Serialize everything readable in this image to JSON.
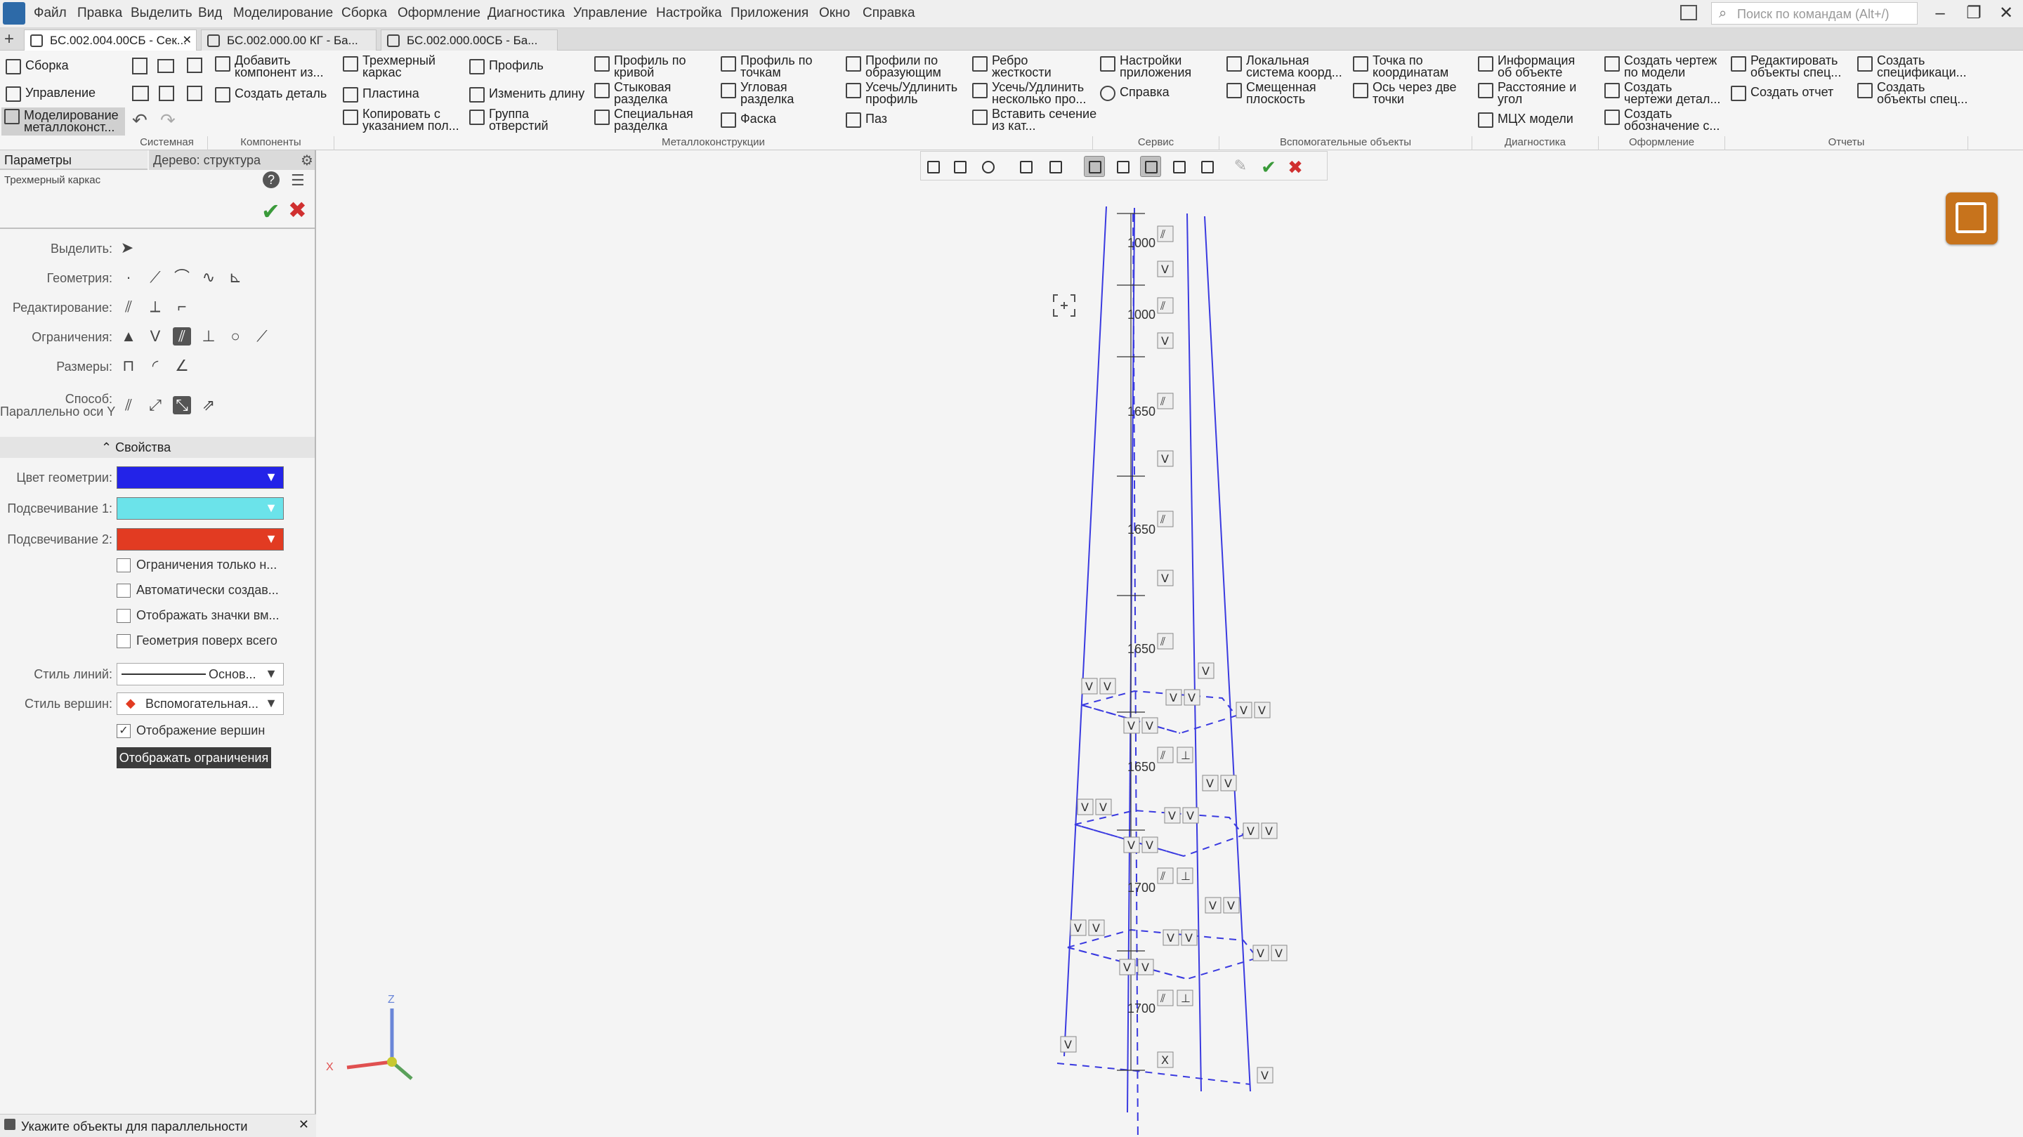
{
  "menu": [
    "Файл",
    "Правка",
    "Выделить",
    "Вид",
    "Моделирование",
    "Сборка",
    "Оформление",
    "Диагностика",
    "Управление",
    "Настройка",
    "Приложения",
    "Окно",
    "Справка"
  ],
  "search": {
    "placeholder": "Поиск по командам (Alt+/)"
  },
  "window": {
    "minimize": "–",
    "restore": "❐",
    "close": "✕"
  },
  "tabs": [
    {
      "label": "БС.002.004.00СБ - Сек...",
      "active": true
    },
    {
      "label": "БС.002.000.00 КГ - Ба...",
      "active": false
    },
    {
      "label": "БС.002.000.00СБ - Ба...",
      "active": false
    }
  ],
  "ribbon": {
    "modes": [
      "Сборка",
      "Управление",
      "Моделирование металлоконст..."
    ],
    "buttons": {
      "add_component": "Добавить компонент из...",
      "create_part": "Создать деталь",
      "frame3d": "Трехмерный каркас",
      "plate": "Пластина",
      "copy_with": "Копировать с указанием пол...",
      "profile": "Профиль",
      "change_length": "Изменить длину",
      "hole_group": "Группа отверстий",
      "profile_curve": "Профиль по кривой",
      "butt_groove": "Стыковая разделка",
      "special_groove": "Специальная разделка",
      "profile_points": "Профиль по точкам",
      "corner_groove": "Угловая разделка",
      "chamfer": "Фаска",
      "profiles_generatrix": "Профили по образующим",
      "trim_extend_profile": "Усечь/Удлинить профиль",
      "slot": "Паз",
      "rib": "Ребро жесткости",
      "trim_extend_multi": "Усечь/Удлинить несколько про...",
      "insert_section": "Вставить сечение из кат...",
      "app_settings": "Настройки приложения",
      "help": "Справка",
      "local_cs": "Локальная система коорд...",
      "offset_plane": "Смещенная плоскость",
      "point_coords": "Точка по координатам",
      "axis_two_points": "Ось через две точки",
      "object_info": "Информация об объекте",
      "distance_angle": "Расстояние и угол",
      "mass_props": "МЦХ модели",
      "create_drawing": "Создать чертеж по модели",
      "create_part_drawings": "Создать чертежи детал...",
      "create_designation": "Создать обозначение с...",
      "edit_spec_objects": "Редактировать объекты спец...",
      "create_report": "Создать отчет",
      "create_spec": "Создать спецификаци...",
      "create_spec_objects": "Создать объекты спец..."
    },
    "groups": [
      "Системная",
      "Компоненты",
      "Металлоконструкции",
      "Сервис",
      "Вспомогательные объекты",
      "Диагностика",
      "Оформление",
      "Отчеты"
    ]
  },
  "panel": {
    "tab_params": "Параметры",
    "tab_tree": "Дерево: структура",
    "subtitle": "Трехмерный каркас",
    "labels": {
      "select": "Выделить:",
      "geometry": "Геометрия:",
      "editing": "Редактирование:",
      "constraints": "Ограничения:",
      "dimensions": "Размеры:",
      "method": "Способ:",
      "method_value": "Параллельно оси Y"
    },
    "properties_title": "Свойства",
    "color_geometry_label": "Цвет геометрии:",
    "highlight1_label": "Подсвечивание 1:",
    "highlight2_label": "Подсвечивание 2:",
    "colors": {
      "geometry": "#2323e8",
      "highlight1": "#6be3ea",
      "highlight2": "#e23b22"
    },
    "checkboxes": [
      {
        "label": "Ограничения только н...",
        "checked": false
      },
      {
        "label": "Автоматически создав...",
        "checked": false
      },
      {
        "label": "Отображать значки вм...",
        "checked": false
      },
      {
        "label": "Геометрия поверх всего",
        "checked": false
      }
    ],
    "line_style_label": "Стиль линий:",
    "line_style_value": "Основ...",
    "vertex_style_label": "Стиль вершин:",
    "vertex_style_value": "Вспомогательная...",
    "show_vertices": {
      "label": "Отображение вершин",
      "checked": true
    },
    "show_constraints_button": "Отображать ограничения"
  },
  "viewport": {
    "dims": [
      "1000",
      "1000",
      "1650",
      "1650",
      "1650",
      "1650",
      "1700",
      "1700"
    ],
    "axes": {
      "x": "X",
      "z": "Z"
    }
  },
  "status": {
    "text": "Укажите объекты для параллельности"
  }
}
